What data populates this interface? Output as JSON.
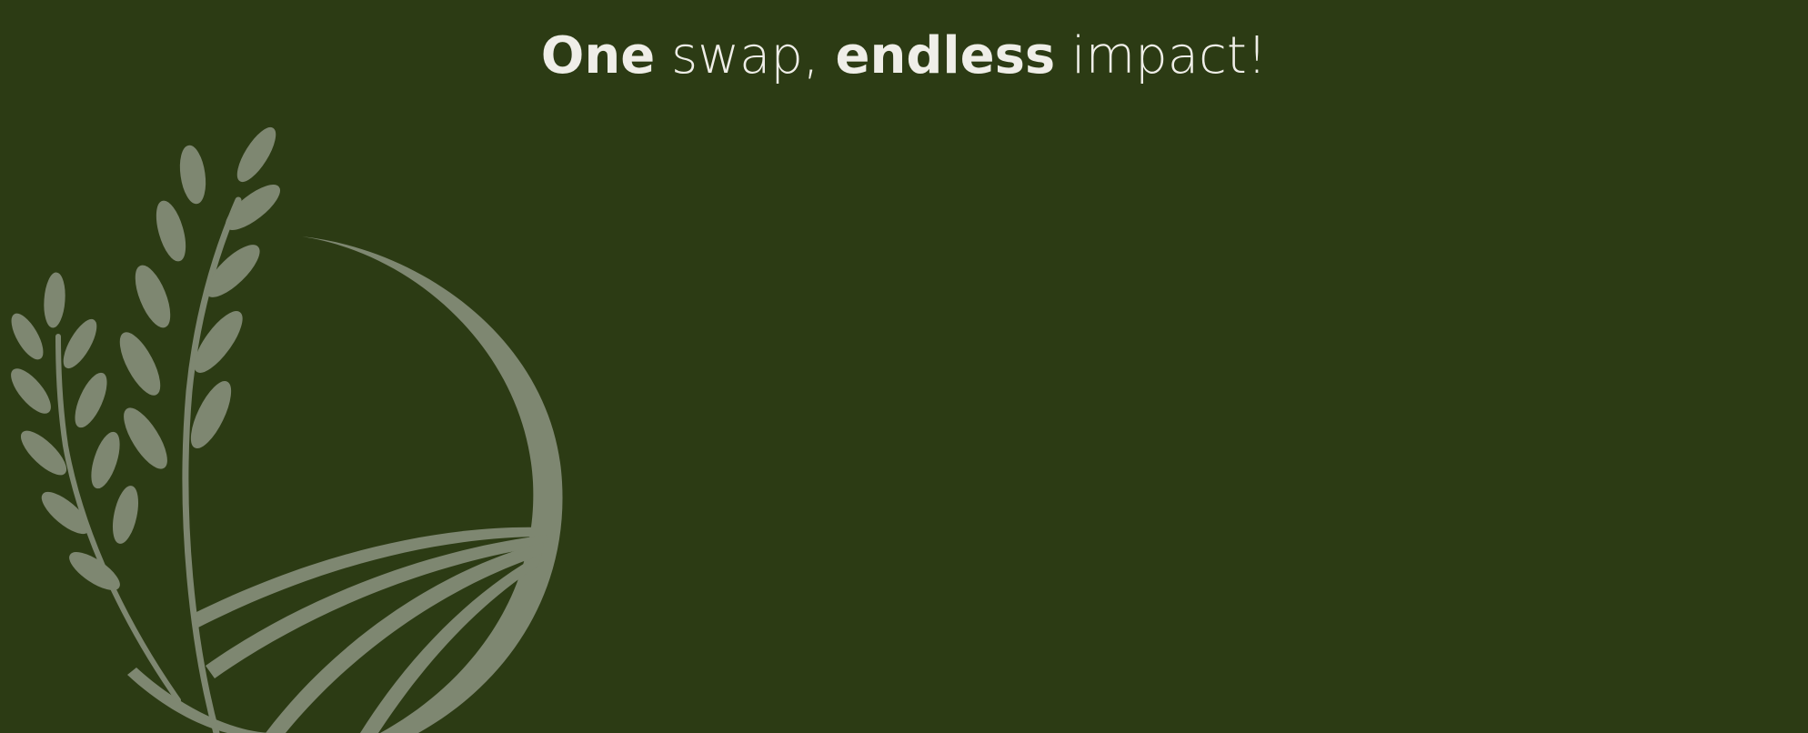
{
  "hero": {
    "headline": {
      "part1": "One",
      "part2": " swap, ",
      "part3": "endless",
      "part4": " impact!"
    },
    "background_color": "#2c3b14",
    "text_color": "#efeee8",
    "logo": {
      "icon": "wheat-field-icon",
      "color": "#7e8771"
    }
  }
}
